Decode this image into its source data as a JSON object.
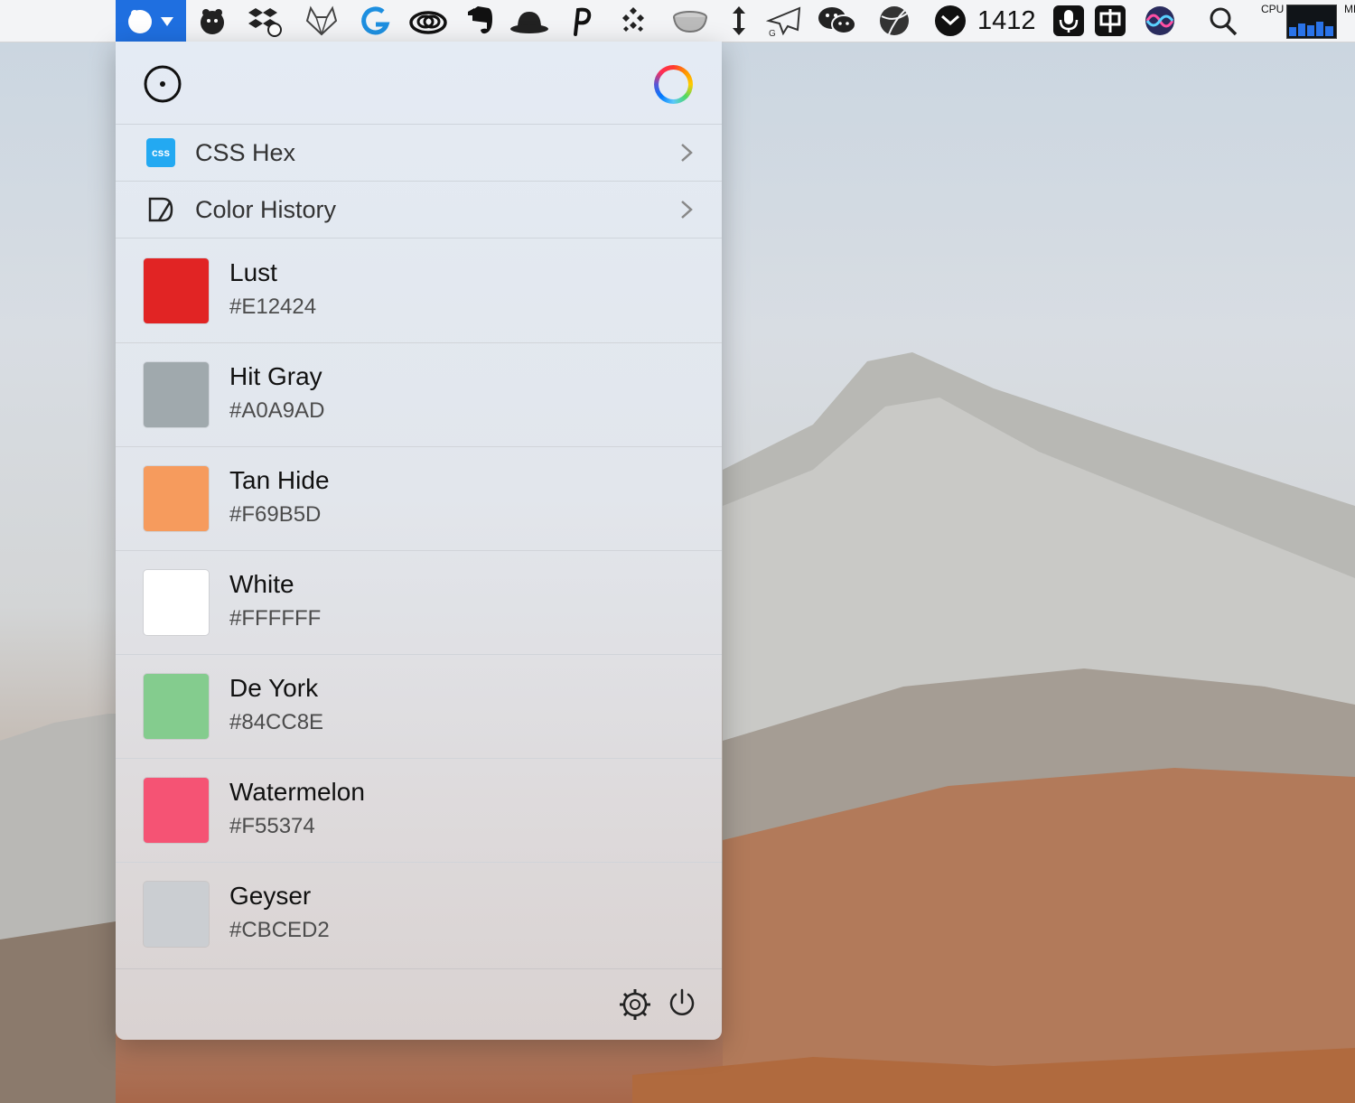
{
  "menubar": {
    "clock_value": "1412",
    "cpu_label": "CPU",
    "mem_label": "MEM"
  },
  "popover": {
    "menu": [
      {
        "label": "CSS Hex",
        "icon_text": "css",
        "icon": "css-icon"
      },
      {
        "label": "Color History",
        "icon": "color-history-icon"
      }
    ],
    "colors": [
      {
        "name": "Lust",
        "hex": "#E12424",
        "swatch": "#E12424"
      },
      {
        "name": "Hit Gray",
        "hex": "#A0A9AD",
        "swatch": "#A0A9AD"
      },
      {
        "name": "Tan Hide",
        "hex": "#F69B5D",
        "swatch": "#F69B5D"
      },
      {
        "name": "White",
        "hex": "#FFFFFF",
        "swatch": "#FFFFFF"
      },
      {
        "name": "De York",
        "hex": "#84CC8E",
        "swatch": "#84CC8E"
      },
      {
        "name": "Watermelon",
        "hex": "#F55374",
        "swatch": "#F55374"
      },
      {
        "name": "Geyser",
        "hex": "#CBCED2",
        "swatch": "#CBCED2"
      }
    ]
  },
  "colors": {
    "menubar_bg": "#f3f4f6",
    "active_item": "#1f6fe0",
    "popover_bg": "#e2e6ec"
  }
}
